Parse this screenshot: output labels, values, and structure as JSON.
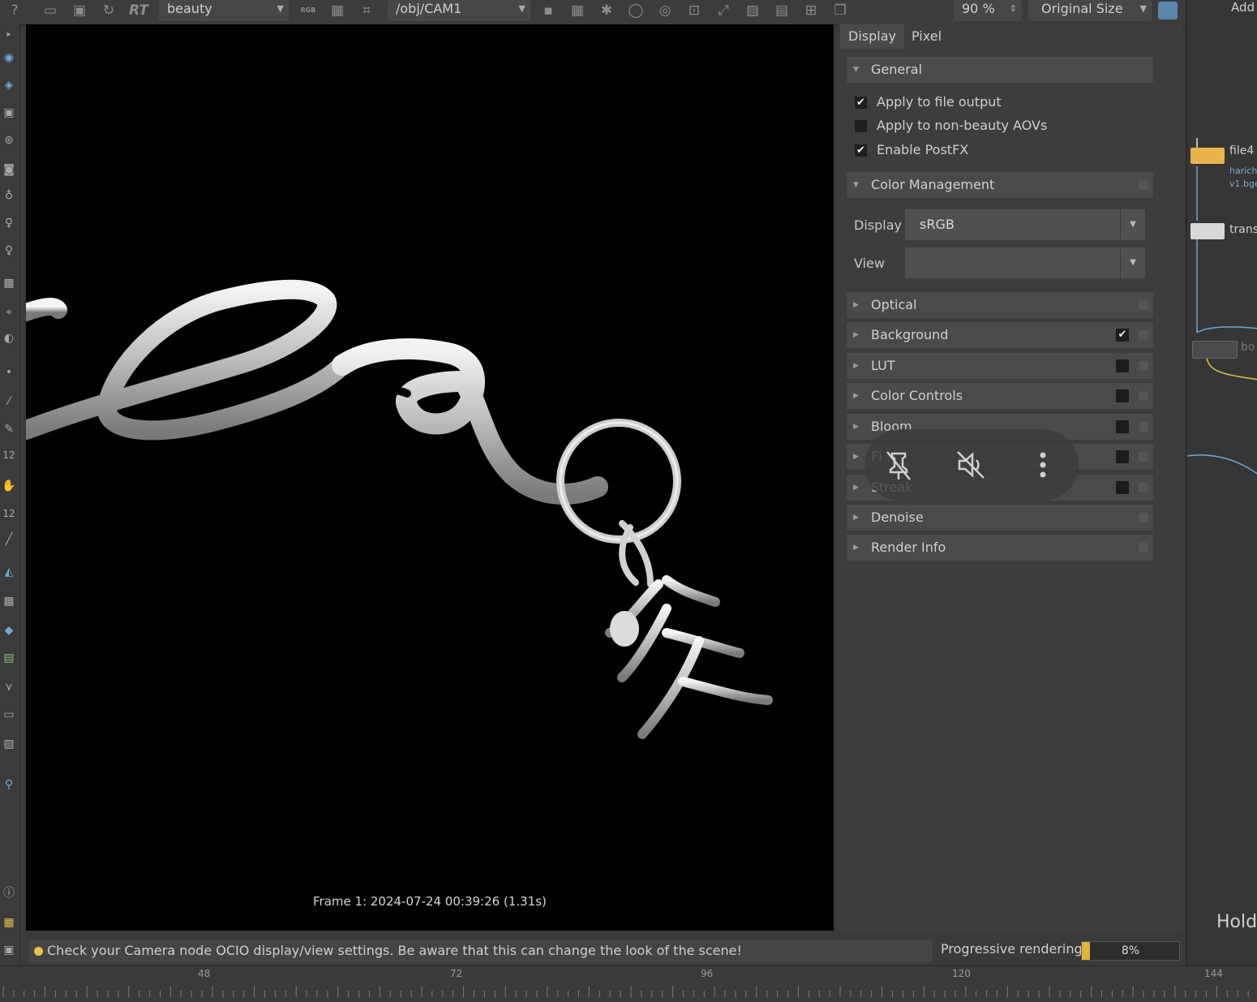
{
  "toolbar": {
    "render_label": "RT",
    "aov_combo": "beauty",
    "rgb_label": "RGB",
    "camera_combo": "/obj/CAM1",
    "zoom_value": "90 %",
    "size_combo": "Original Size"
  },
  "left_tools": {
    "label_12a": "12",
    "label_12b": "12"
  },
  "viewport": {
    "frame_info": "Frame 1:  2024-07-24  00:39:26  (1.31s)"
  },
  "panel": {
    "tabs": [
      "Display",
      "Pixel"
    ],
    "general": {
      "title": "General",
      "options": [
        {
          "label": "Apply to file output",
          "checked": true
        },
        {
          "label": "Apply to non-beauty AOVs",
          "checked": false
        },
        {
          "label": "Enable PostFX",
          "checked": true
        }
      ]
    },
    "color_management": {
      "title": "Color Management",
      "display_label": "Display",
      "display_value": "sRGB",
      "view_label": "View",
      "view_value": ""
    },
    "sections": [
      {
        "label": "Optical",
        "has_check": false,
        "checked": false
      },
      {
        "label": "Background",
        "has_check": true,
        "checked": true
      },
      {
        "label": "LUT",
        "has_check": true,
        "checked": false
      },
      {
        "label": "Color Controls",
        "has_check": true,
        "checked": false
      },
      {
        "label": "Bloom",
        "has_check": true,
        "checked": false
      },
      {
        "label": "Fl",
        "has_check": true,
        "checked": false
      },
      {
        "label": "Streak",
        "has_check": true,
        "checked": false
      },
      {
        "label": "Denoise",
        "has_check": false,
        "checked": false
      },
      {
        "label": "Render Info",
        "has_check": false,
        "checked": false
      }
    ]
  },
  "network": {
    "add_label": "Add",
    "node1_label": "file4",
    "node1_sub1": "harich",
    "node1_sub2": "v1.bge",
    "node2_label": "transf",
    "node3_label": "bo",
    "hold_label": "Hold"
  },
  "status": {
    "message": "Check your Camera node OCIO display/view settings. Be aware that this can change the look of the scene!",
    "progress_label": "Progressive rendering",
    "progress_percent": 8,
    "progress_text": "8%"
  },
  "timeline": {
    "ticks": [
      "48",
      "72",
      "96",
      "120",
      "144"
    ]
  },
  "colors": {
    "status_dot": "#e7c44a",
    "progress_fill": "#e0b33a",
    "accent_blue": "#6fa8d8"
  }
}
